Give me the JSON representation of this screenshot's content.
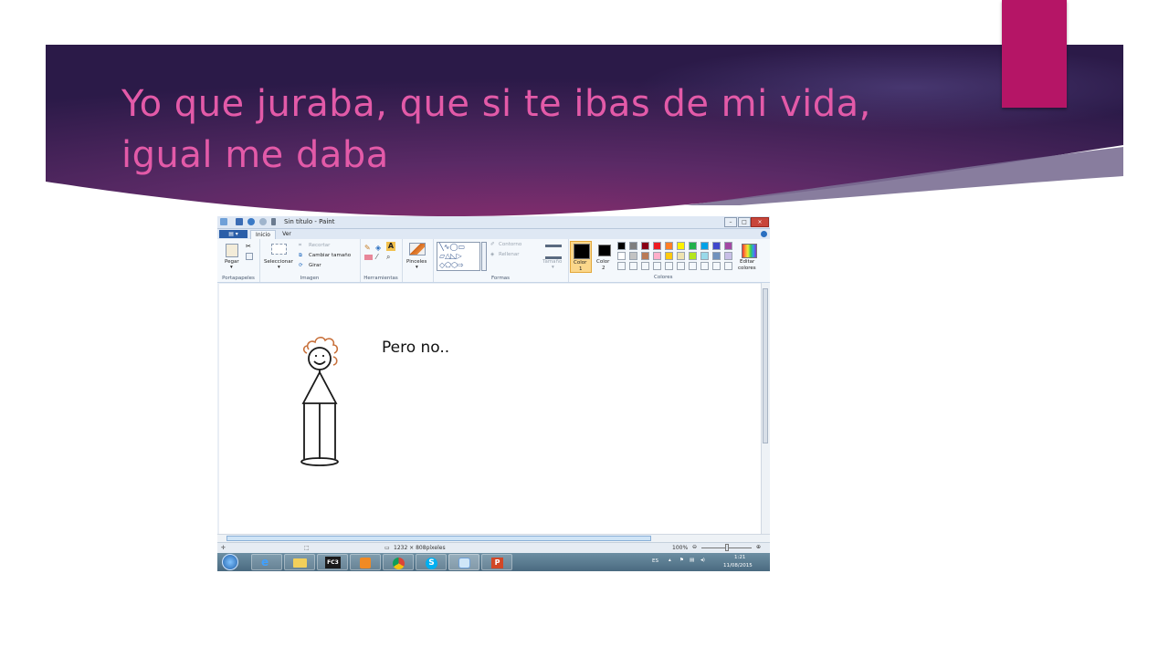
{
  "slide": {
    "title": "Yo que juraba, que si te ibas de mi vida, igual me daba",
    "colors": {
      "header_dark": "#2b1745",
      "header_mid": "#6a2b6c",
      "title": "#e35aa8",
      "accent": "#b51566"
    }
  },
  "paint": {
    "window_title": "Sin título - Paint",
    "tabs": [
      "Inicio",
      "Ver"
    ],
    "ribbon": {
      "portapapeles": {
        "label": "Portapapeles",
        "paste": "Pegar"
      },
      "imagen": {
        "label": "Imagen",
        "select": "Seleccionar",
        "crop": "Recortar",
        "resize": "Cambiar tamaño",
        "rotate": "Girar"
      },
      "herramientas": {
        "label": "Herramientas"
      },
      "brushes": "Pinceles",
      "formas": {
        "label": "Formas",
        "outline": "Contorno",
        "fill": "Rellenar"
      },
      "size": "Tamaño",
      "color1": {
        "label": "Color",
        "num": "1"
      },
      "color2": {
        "label": "Color",
        "num": "2"
      },
      "colores": {
        "label": "Colores",
        "edit_line1": "Editar",
        "edit_line2": "colores",
        "palette_row1": [
          "#000000",
          "#7f7f7f",
          "#880015",
          "#ed1c24",
          "#ff7f27",
          "#fff200",
          "#22b14c",
          "#00a2e8",
          "#3f48cc",
          "#a349a4"
        ],
        "palette_row2": [
          "#ffffff",
          "#c3c3c3",
          "#b97a57",
          "#ffaec9",
          "#ffc90e",
          "#efe4b0",
          "#b5e61d",
          "#99d9ea",
          "#7092be",
          "#c8bfe7"
        ]
      }
    },
    "canvas_text": "Pero no..",
    "status": {
      "dimensions": "1232 × 808píxeles",
      "zoom": "100%"
    },
    "taskbar": {
      "lang": "ES",
      "time": "1:21",
      "date": "11/08/2015"
    }
  }
}
